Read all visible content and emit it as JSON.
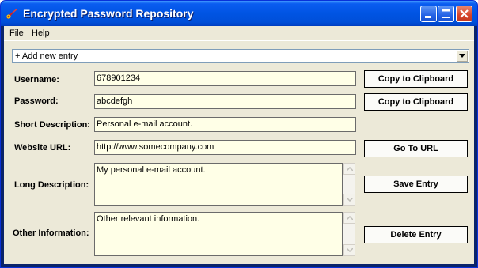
{
  "window": {
    "title": "Encrypted Password Repository",
    "icons": {
      "app": "key-icon",
      "minimize": "minimize-icon",
      "maximize": "maximize-icon",
      "close": "close-icon"
    }
  },
  "menu": {
    "file": "File",
    "help": "Help"
  },
  "entry_selector": {
    "selected": "+ Add new entry",
    "arrow_icon": "chevron-down-icon"
  },
  "form": {
    "username": {
      "label": "Username:",
      "value": "678901234",
      "copy_button": "Copy to Clipboard"
    },
    "password": {
      "label": "Password:",
      "value": "abcdefgh",
      "copy_button": "Copy to Clipboard"
    },
    "short_description": {
      "label": "Short Description:",
      "value": "Personal e-mail account."
    },
    "website_url": {
      "label": "Website URL:",
      "value": "http://www.somecompany.com",
      "button": "Go To URL"
    },
    "long_description": {
      "label": "Long Description:",
      "value": "My personal e-mail account.",
      "button": "Save Entry"
    },
    "other_information": {
      "label": "Other Information:",
      "value": "Other relevant information.",
      "button": "Delete Entry"
    }
  }
}
